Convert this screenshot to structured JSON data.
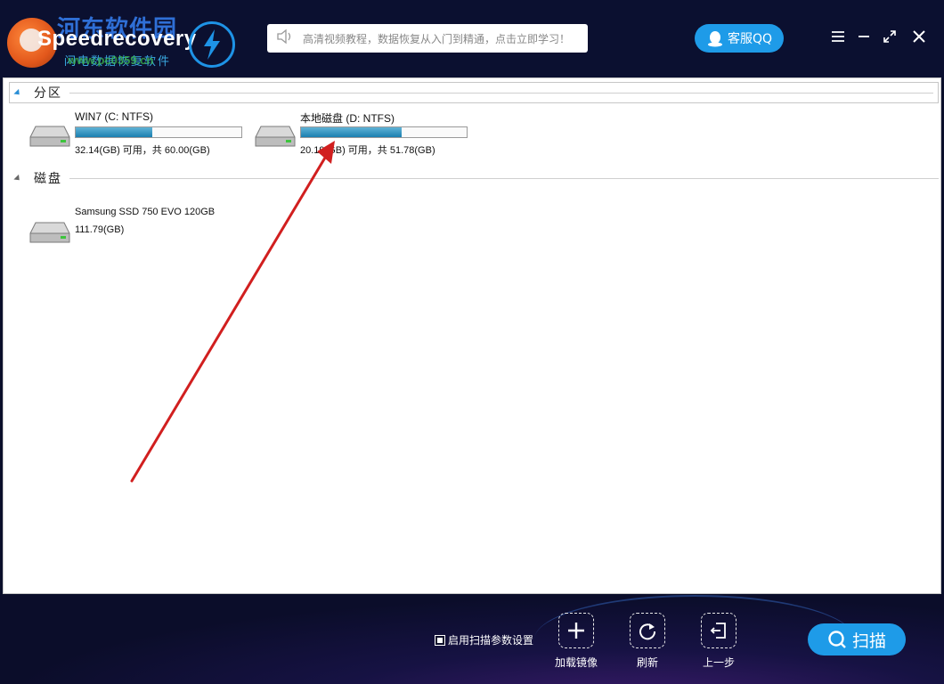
{
  "header": {
    "watermark": "河东软件园",
    "brand": "Speedrecovery",
    "subtitle": "闪电数据恢复软件",
    "watermark_url": "www.pc0359.cn",
    "notice": "高清视频教程，数据恢复从入门到精通，点击立即学习！",
    "qq_label": "客服QQ"
  },
  "sections": {
    "partitions_title": "分区",
    "disks_title": "磁盘"
  },
  "partitions": [
    {
      "name": "WIN7 (C: NTFS)",
      "info": "32.14(GB) 可用，共 60.00(GB)",
      "used_fraction": 0.46
    },
    {
      "name": "本地磁盘 (D: NTFS)",
      "info": "20.19(GB) 可用，共 51.78(GB)",
      "used_fraction": 0.61
    }
  ],
  "disks": [
    {
      "name": "Samsung SSD 750 EVO 120GB",
      "info": "111.79(GB)"
    }
  ],
  "footer": {
    "scan_settings_label": "启用扫描参数设置",
    "load_image_label": "加载镜像",
    "refresh_label": "刷新",
    "back_label": "上一步",
    "scan_label": "扫描"
  },
  "colors": {
    "accent": "#1e9be8",
    "bar_fill": "#1b7fb0",
    "annotation_arrow": "#d11f1f"
  }
}
